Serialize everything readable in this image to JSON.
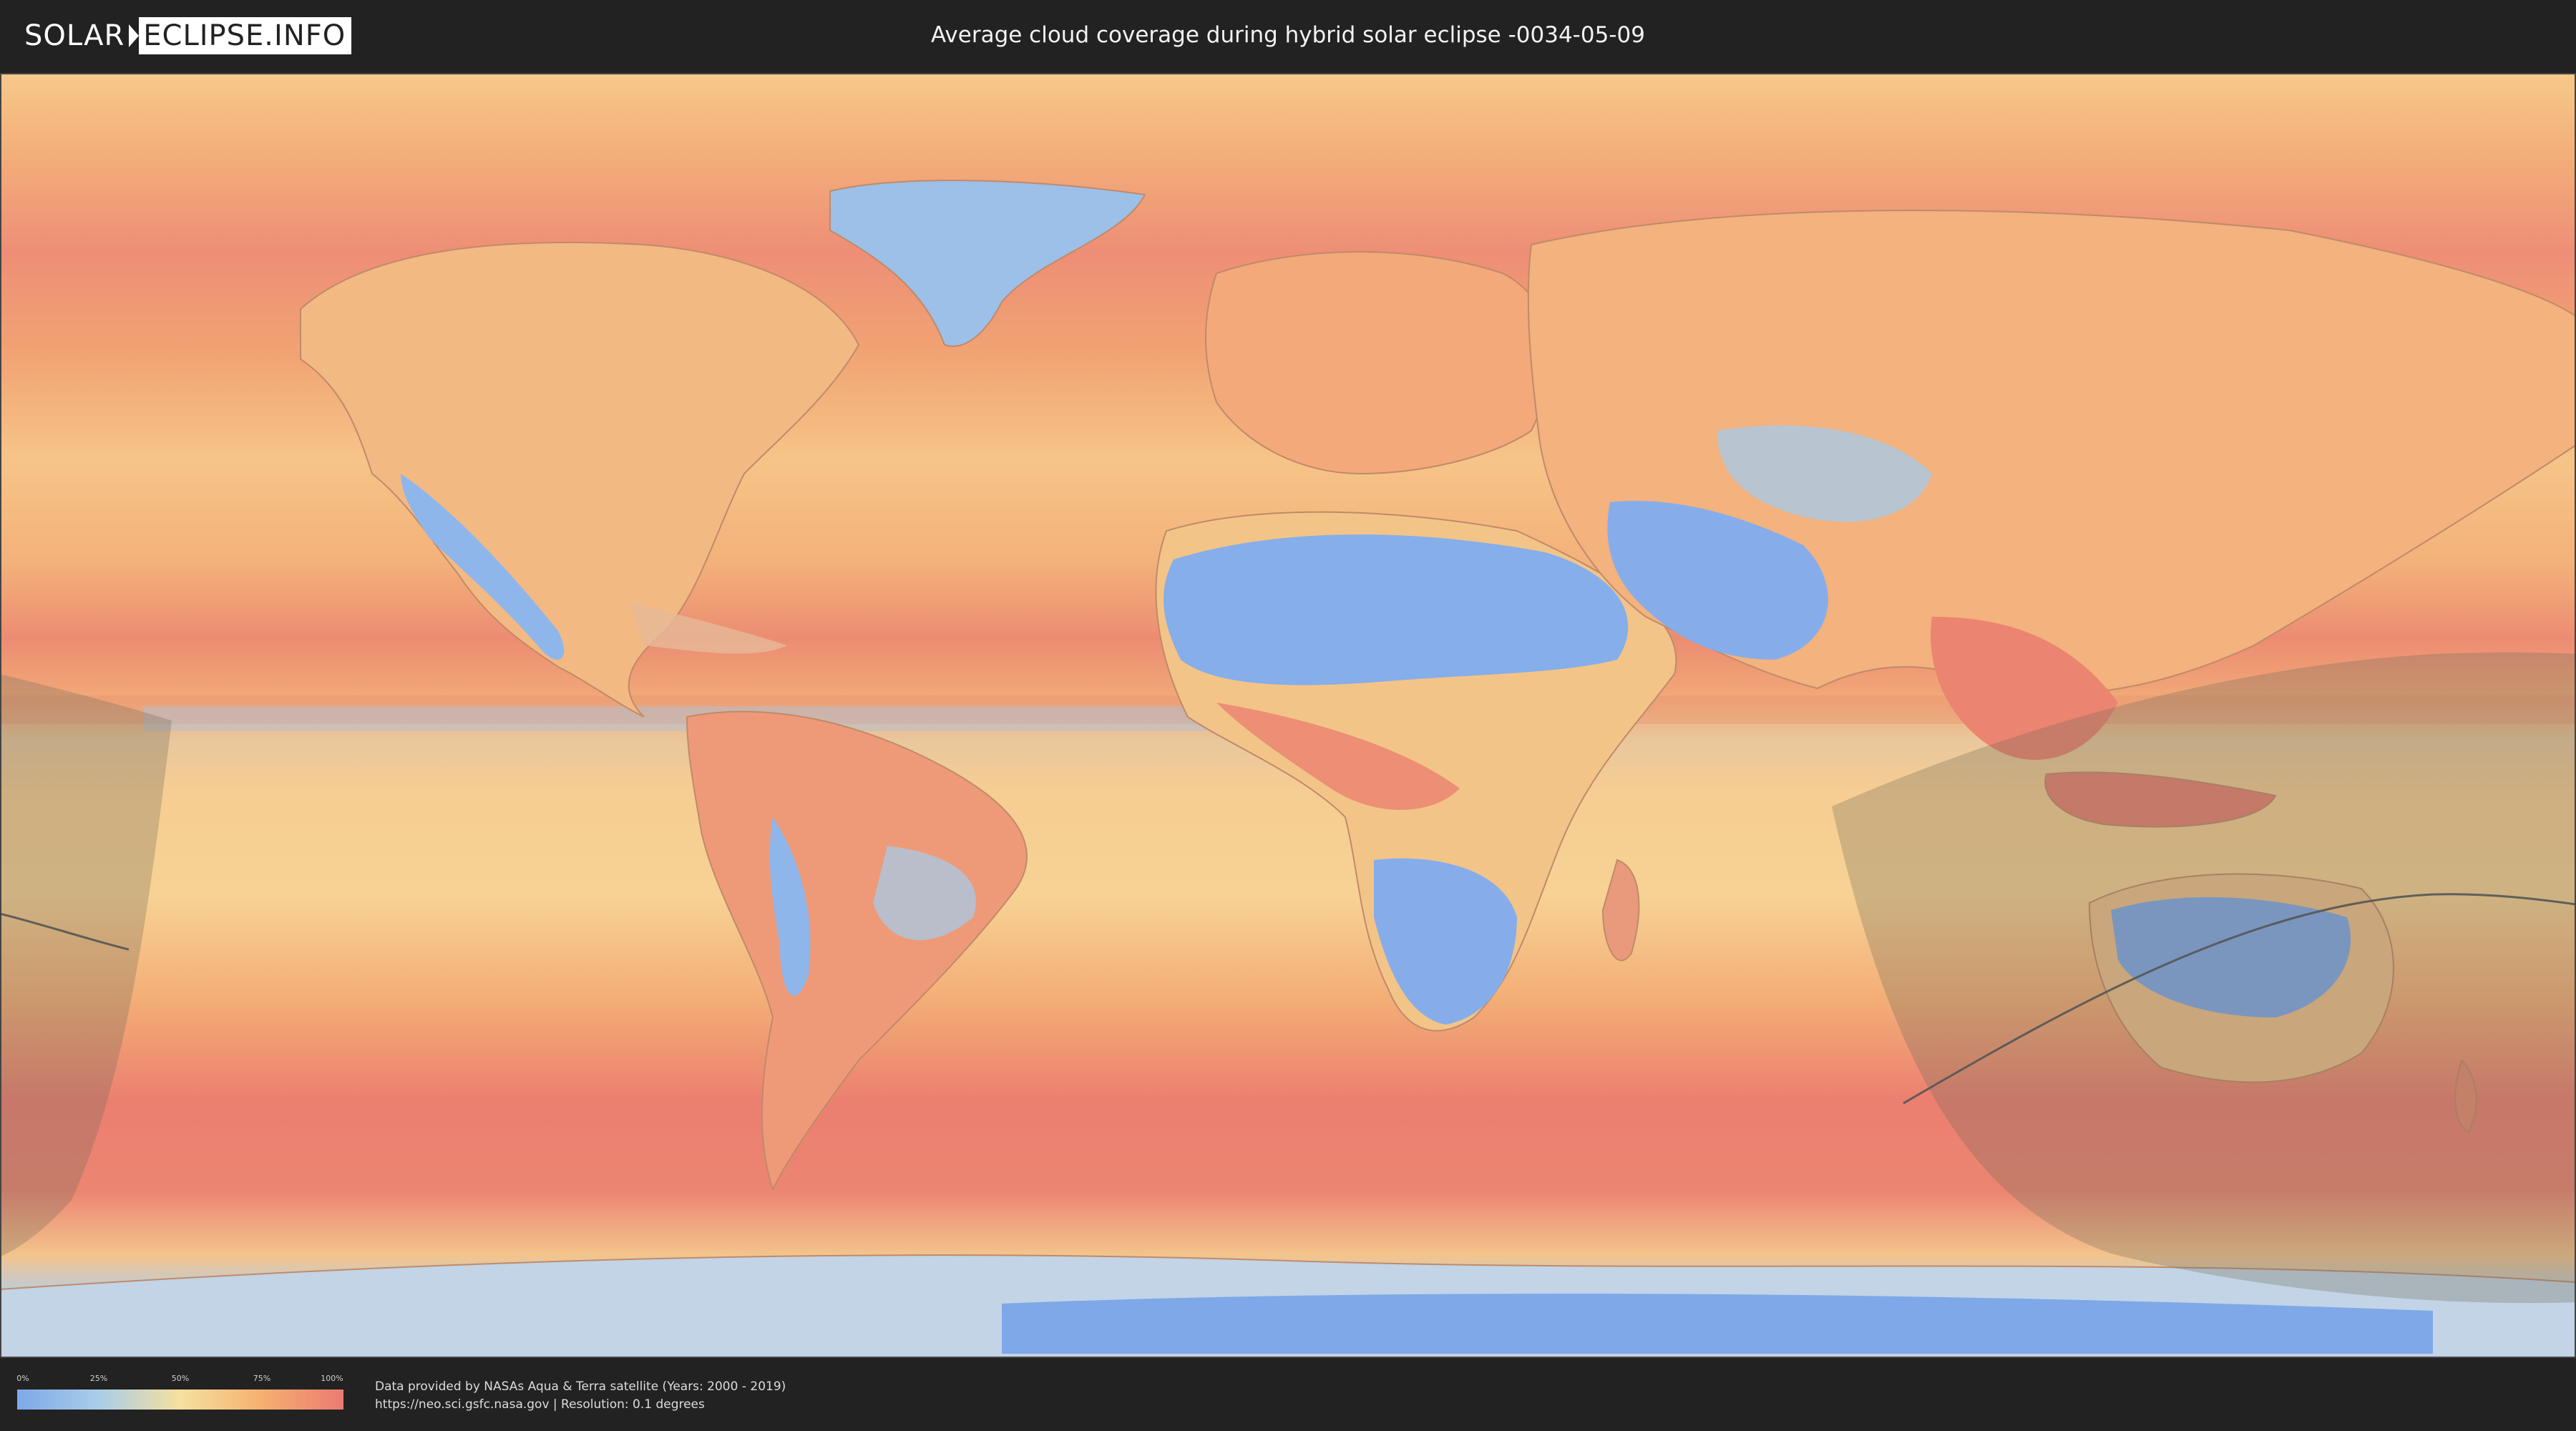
{
  "header": {
    "logo_left": "SOLAR",
    "logo_right": "ECLIPSE.INFO",
    "title": "Average cloud coverage during hybrid solar eclipse -0034-05-09"
  },
  "map": {
    "projection": "equirectangular world map",
    "layer": "average cloud coverage",
    "overlay": "eclipse visibility zone with central path",
    "colors": {
      "clear": "#7ea8e8",
      "low": "#a9cde8",
      "mid": "#f6d08e",
      "high": "#f5a66b",
      "overcast": "#ec7a72",
      "shadow": "#6f6a5a",
      "path": "#555555"
    }
  },
  "legend": {
    "ticks": [
      "0%",
      "25%",
      "50%",
      "75%",
      "100%"
    ],
    "gradient": [
      "#7ea8e8",
      "#a9cde8",
      "#f6e09e",
      "#f5b070",
      "#ec7a72"
    ]
  },
  "credits": {
    "line1": "Data provided by NASAs Aqua & Terra satellite (Years: 2000 - 2019)",
    "line2": "https://neo.sci.gsfc.nasa.gov | Resolution: 0.1 degrees"
  }
}
